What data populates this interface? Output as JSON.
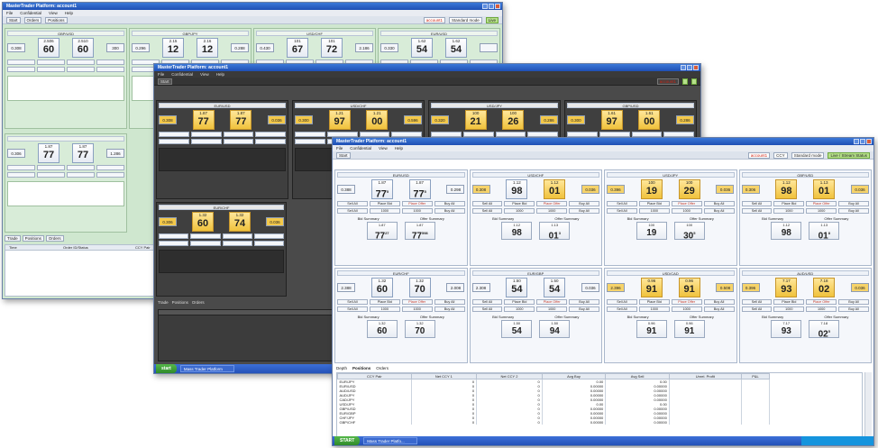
{
  "windows": {
    "back": {
      "title": "MasterTrader Platform: account1",
      "menu": [
        "File",
        "Confidential",
        "View",
        "Help"
      ],
      "toolbar_items": [
        "Start",
        "Orders",
        "Positions"
      ],
      "instruments": [
        "GBP/USD",
        "GBP/JPY",
        "USD/CHF",
        "EUR/USD"
      ],
      "ladders_row1": [
        {
          "left": "0.308",
          "bid_small": "2.506",
          "bid_big": "60",
          "ask_small": "2.510",
          "ask_big": "60",
          "right": "300"
        },
        {
          "left": "0.296",
          "bid_small": "2.15",
          "bid_big": "12",
          "ask_small": "2.16",
          "ask_big": "12",
          "right": "0.288"
        },
        {
          "left": "0.430",
          "bid_small": "101",
          "bid_big": "67",
          "ask_small": "101",
          "ask_big": "72",
          "right": "2.186"
        },
        {
          "left": "0.330",
          "bid_small": "1.62",
          "bid_big": "54",
          "ask_small": "1.62",
          "ask_big": "54",
          "right": ""
        }
      ],
      "ladders_row2": [
        {
          "left": "0.306",
          "bid_small": "1.87",
          "bid_big": "77",
          "ask_small": "1.87",
          "ask_big": "77",
          "right": "1.286"
        }
      ],
      "bottom_tabs": [
        "Trade",
        "Positions",
        "Orders"
      ],
      "grid_headers": [
        "Time",
        "Order ID/Status",
        "CCY Pair"
      ]
    },
    "middle": {
      "title": "MasterTrader Platform: account1",
      "menu": [
        "File",
        "Confidential",
        "View",
        "Help"
      ],
      "ladders_row1": [
        {
          "name": "EUR/USD",
          "left": "0.308",
          "bid_small": "1.87",
          "bid_big": "77",
          "ask_small": "1.87",
          "ask_big": "77",
          "right": "0.036"
        },
        {
          "name": "USD/CHF",
          "left": "0.300",
          "bid_small": "1.21",
          "bid_big": "97",
          "ask_small": "1.21",
          "ask_big": "00",
          "right": "0.596"
        },
        {
          "name": "USD/JPY",
          "left": "0.320",
          "bid_small": "100",
          "bid_big": "21",
          "ask_small": "100",
          "ask_big": "26",
          "right": "0.286"
        },
        {
          "name": "GBP/USD",
          "left": "0.300",
          "bid_small": "1.61",
          "bid_big": "97",
          "ask_small": "1.61",
          "ask_big": "00",
          "right": "0.286"
        }
      ],
      "ladders_row2": [
        {
          "name": "EUR/CHF",
          "left": "0.306",
          "bid_small": "1.32",
          "bid_big": "60",
          "ask_small": "1.32",
          "ask_big": "74",
          "right": "0.036"
        }
      ],
      "bottom_tabs": [
        "Trade",
        "Positions",
        "Orders"
      ],
      "task_item": "Mass Trader Platform"
    },
    "front": {
      "title": "MasterTrader Platform: account1",
      "menu": [
        "File",
        "Confidential",
        "View",
        "Help"
      ],
      "toolbar": {
        "start": "Start",
        "account": "account1",
        "ccy": "CCY",
        "mode": "Standard mode",
        "status": "Live / Stream Status"
      },
      "summary_labels": {
        "bid": "Bid Summary",
        "offer": "Offer Summary"
      },
      "controls": {
        "sell_all": "Sell All",
        "place_bid": "Place Bid",
        "place_offer": "Place Offer",
        "buy_all": "Buy All",
        "qty": "1000"
      },
      "ladders": [
        {
          "name": "EUR/USD",
          "left": "0.388",
          "bid_small": "1.87",
          "bid_big": "77",
          "bid_sup": "5",
          "ask_small": "1.87",
          "ask_big": "77",
          "ask_sup": "5",
          "right": "0.298",
          "ask_hl": false,
          "sum_bid_small": "1.87",
          "sum_bid_big": "77",
          "sum_bid_sup": "27",
          "sum_ask_small": "1.87",
          "sum_ask_big": "77",
          "sum_ask_sup": "598"
        },
        {
          "name": "USD/CHF",
          "left": "0.308",
          "bid_small": "1.12",
          "bid_big": "98",
          "bid_sup": "",
          "ask_small": "1.12",
          "ask_big": "01",
          "ask_sup": "",
          "right": "0.036",
          "ask_hl": true,
          "sum_bid_small": "1.12",
          "sum_bid_big": "98",
          "sum_bid_sup": "",
          "sum_ask_small": "1.13",
          "sum_ask_big": "01",
          "sum_ask_sup": "3"
        },
        {
          "name": "USD/JPY",
          "left": "0.396",
          "bid_small": "100",
          "bid_big": "19",
          "bid_sup": "",
          "ask_small": "100",
          "ask_big": "29",
          "ask_sup": "",
          "right": "0.036",
          "ask_hl": true,
          "sum_bid_small": "100",
          "sum_bid_big": "19",
          "sum_bid_sup": "",
          "sum_ask_small": "100",
          "sum_ask_big": "30",
          "sum_ask_sup": "5"
        },
        {
          "name": "GBP/USD",
          "left": "0.306",
          "bid_small": "1.12",
          "bid_big": "98",
          "bid_sup": "",
          "ask_small": "1.13",
          "ask_big": "01",
          "ask_sup": "",
          "right": "0.036",
          "ask_hl": true,
          "sum_bid_small": "1.12",
          "sum_bid_big": "98",
          "sum_bid_sup": "",
          "sum_ask_small": "1.13",
          "sum_ask_big": "01",
          "sum_ask_sup": "8"
        },
        {
          "name": "EUR/CHF",
          "left": "2.388",
          "bid_small": "1.32",
          "bid_big": "60",
          "bid_sup": "",
          "ask_small": "1.32",
          "ask_big": "70",
          "ask_sup": "",
          "right": "2.008",
          "ask_hl": false,
          "sum_bid_small": "1.32",
          "sum_bid_big": "60",
          "sum_bid_sup": "",
          "sum_ask_small": "1.32",
          "sum_ask_big": "70",
          "sum_ask_sup": ""
        },
        {
          "name": "EUR/GBP",
          "left": "2.308",
          "bid_small": "1.50",
          "bid_big": "54",
          "bid_sup": "",
          "ask_small": "1.50",
          "ask_big": "54",
          "ask_sup": "",
          "right": "0.036",
          "ask_hl": false,
          "sum_bid_small": "1.50",
          "sum_bid_big": "54",
          "sum_bid_sup": "",
          "sum_ask_small": "1.50",
          "sum_ask_big": "94",
          "sum_ask_sup": ""
        },
        {
          "name": "USD/CAD",
          "left": "2.396",
          "bid_small": "0.96",
          "bid_big": "91",
          "bid_sup": "",
          "ask_small": "0.96",
          "ask_big": "91",
          "ask_sup": "",
          "right": "0.508",
          "ask_hl": true,
          "sum_bid_small": "0.96",
          "sum_bid_big": "91",
          "sum_bid_sup": "",
          "sum_ask_small": "0.96",
          "sum_ask_big": "91",
          "sum_ask_sup": ""
        },
        {
          "name": "AUD/USD",
          "left": "0.396",
          "bid_small": "7.17",
          "bid_big": "93",
          "bid_sup": "",
          "ask_small": "7.18",
          "ask_big": "02",
          "ask_sup": "",
          "right": "0.036",
          "ask_hl": true,
          "sum_bid_small": "7.17",
          "sum_bid_big": "93",
          "sum_bid_sup": "",
          "sum_ask_small": "7.18",
          "sum_ask_big": "02",
          "sum_ask_sup": "5"
        }
      ],
      "bottom_tabs": [
        "Depth",
        "Positions",
        "Orders"
      ],
      "grid_headers": [
        "CCY Pair",
        "Net CCY 1",
        "Net CCY 2",
        "Avg Buy",
        "Avg Sell",
        "Unrel. Profit",
        "P&L"
      ],
      "grid_rows": [
        [
          "EUR/JPY",
          "0",
          "0",
          "0.00",
          "0.00",
          "",
          ""
        ],
        [
          "EUR/USD",
          "0",
          "0",
          "0.00000",
          "0.00000",
          "",
          ""
        ],
        [
          "AUD/USD",
          "0",
          "0",
          "0.00000",
          "0.00000",
          "",
          ""
        ],
        [
          "AUD/JPY",
          "0",
          "0",
          "0.00000",
          "0.00000",
          "",
          ""
        ],
        [
          "CAD/JPY",
          "0",
          "0",
          "0.00000",
          "0.00000",
          "",
          ""
        ],
        [
          "USD/JPY",
          "0",
          "0",
          "0.00",
          "0.00",
          "",
          ""
        ],
        [
          "GBP/USD",
          "0",
          "0",
          "0.00000",
          "0.00000",
          "",
          ""
        ],
        [
          "EUR/GBP",
          "0",
          "0",
          "0.00000",
          "0.00000",
          "",
          ""
        ],
        [
          "CHF/JPY",
          "0",
          "0",
          "0.00000",
          "0.00000",
          "",
          ""
        ],
        [
          "GBP/CHF",
          "0",
          "0",
          "0.00000",
          "0.00000",
          "",
          ""
        ]
      ],
      "taskbar": {
        "start": "START",
        "item": "Mass Trader Platfo..."
      }
    }
  }
}
